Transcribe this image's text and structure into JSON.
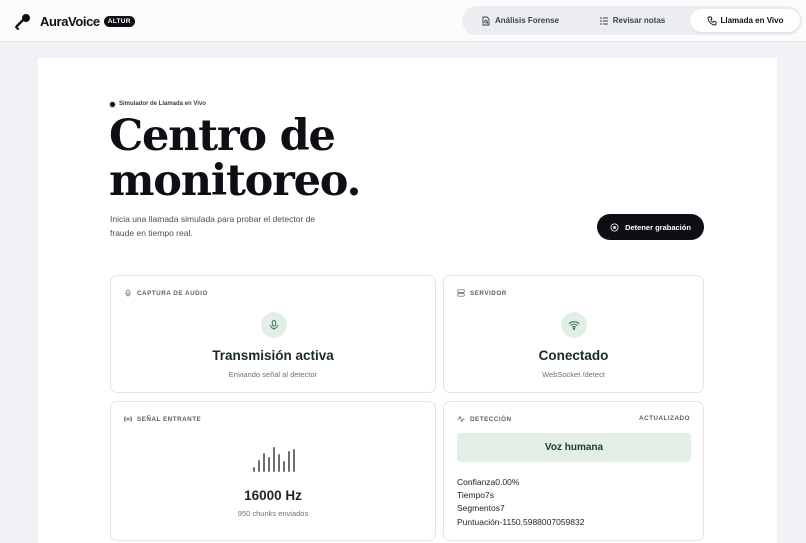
{
  "app": {
    "name": "AuraVoice",
    "badge": "ALTUR"
  },
  "nav": {
    "tabs": [
      {
        "label": "Análisis Forense",
        "icon": "document-search-icon"
      },
      {
        "label": "Revisar notas",
        "icon": "list-icon"
      },
      {
        "label": "Llamada en Vivo",
        "icon": "phone-icon",
        "active": true
      }
    ]
  },
  "hero": {
    "eyebrow": "Simulador de Llamada en Vivo",
    "title_line1": "Centro de",
    "title_line2": "monitoreo.",
    "description": "Inicia una llamada simulada para probar el detector de fraude en tiempo real.",
    "stop_button": "Detener grabación"
  },
  "panels": {
    "audio": {
      "label": "CAPTURA DE AUDIO",
      "title": "Transmisión activa",
      "subtitle": "Enviando señal al detector"
    },
    "server": {
      "label": "SERVIDOR",
      "title": "Conectado",
      "subtitle": "WebSocket /detect"
    },
    "signal": {
      "label": "SEÑAL ENTRANTE",
      "title": "16000 Hz",
      "subtitle": "950 chunks enviados"
    },
    "detection": {
      "label": "DETECCIÓN",
      "status": "ACTUALIZADO",
      "verdict": "Voz humana",
      "metrics": [
        "Confianza0.00%",
        "Tiempo7s",
        "Segmentos7",
        "Puntuación-1150.5988007059832"
      ]
    }
  },
  "colors": {
    "accent_dark": "#0d0f14",
    "accent_green_bg": "#e1efe7",
    "accent_green": "#3f7a58"
  }
}
